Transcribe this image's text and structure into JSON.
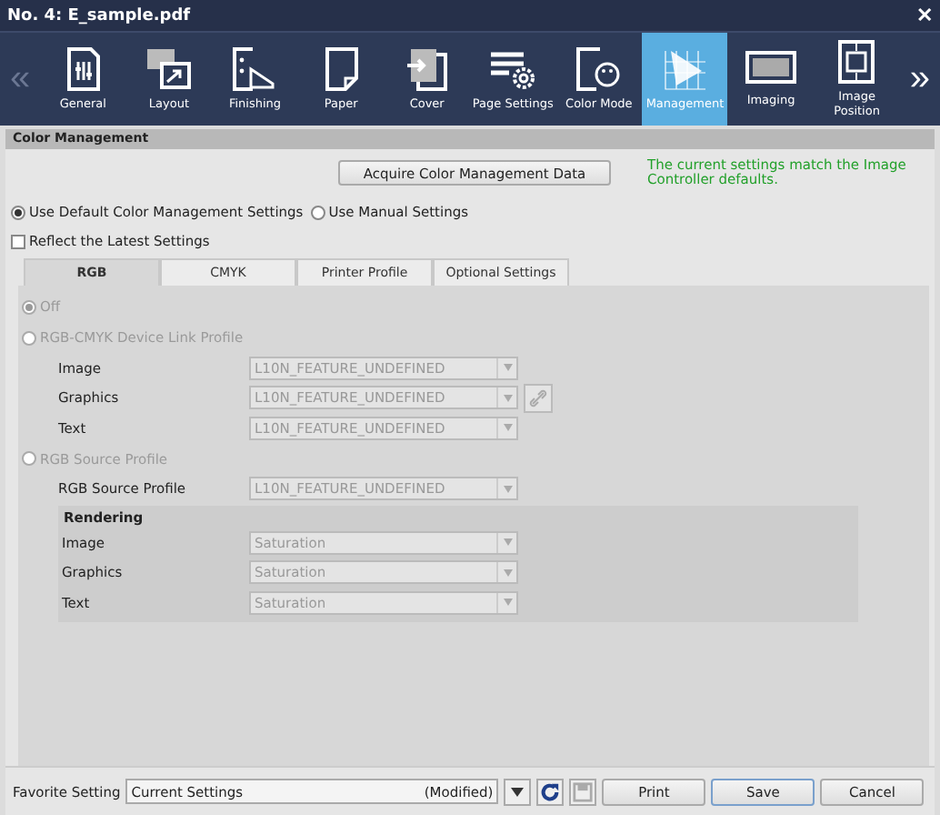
{
  "window": {
    "title": "No. 4: E_sample.pdf",
    "close": "✕"
  },
  "toolbar": {
    "prev": "«",
    "next": "»",
    "items": [
      {
        "label": "General",
        "kind": "general",
        "selected": false
      },
      {
        "label": "Layout",
        "kind": "layout",
        "selected": false
      },
      {
        "label": "Finishing",
        "kind": "finishing",
        "selected": false
      },
      {
        "label": "Paper",
        "kind": "paper",
        "selected": false
      },
      {
        "label": "Cover",
        "kind": "cover",
        "selected": false
      },
      {
        "label": "Page Settings",
        "kind": "pagesettings",
        "selected": false
      },
      {
        "label": "Color Mode",
        "kind": "colormode",
        "selected": false
      },
      {
        "label": "Management",
        "kind": "management",
        "selected": true
      },
      {
        "label": "Imaging",
        "kind": "imaging",
        "selected": false
      },
      {
        "label": "Image Position",
        "kind": "position",
        "selected": false
      }
    ]
  },
  "section_title": "Color Management",
  "acquire_button": "Acquire Color Management Data",
  "status_message": "The current settings match the Image Controller defaults.",
  "mode_options": [
    {
      "label": "Use Default Color Management Settings",
      "selected": true
    },
    {
      "label": "Use Manual Settings",
      "selected": false
    }
  ],
  "reflect_checkbox": {
    "label": "Reflect the Latest Settings",
    "checked": false
  },
  "tabs": [
    {
      "label": "RGB",
      "selected": true
    },
    {
      "label": "CMYK",
      "selected": false
    },
    {
      "label": "Printer Profile",
      "selected": false
    },
    {
      "label": "Optional Settings",
      "selected": false
    }
  ],
  "rgb_options": [
    {
      "label": "Off",
      "selected": true
    },
    {
      "label": "RGB-CMYK Device Link Profile",
      "selected": false,
      "rows": [
        {
          "label": "Image",
          "value": "L10N_FEATURE_UNDEFINED",
          "link": false
        },
        {
          "label": "Graphics",
          "value": "L10N_FEATURE_UNDEFINED",
          "link": true
        },
        {
          "label": "Text",
          "value": "L10N_FEATURE_UNDEFINED",
          "link": false
        }
      ]
    },
    {
      "label": "RGB Source Profile",
      "selected": false,
      "rows": [
        {
          "label": "RGB Source Profile",
          "value": "L10N_FEATURE_UNDEFINED",
          "link": false
        }
      ]
    }
  ],
  "rendering": {
    "title": "Rendering",
    "rows": [
      {
        "label": "Image",
        "value": "Saturation"
      },
      {
        "label": "Graphics",
        "value": "Saturation"
      },
      {
        "label": "Text",
        "value": "Saturation"
      }
    ]
  },
  "footer": {
    "favorite_label": "Favorite Setting",
    "favorite_value": "Current Settings",
    "favorite_note": "(Modified)",
    "buttons": [
      {
        "label": "Print",
        "kind": "normal"
      },
      {
        "label": "Save",
        "kind": "default"
      },
      {
        "label": "Cancel",
        "kind": "normal"
      }
    ]
  }
}
